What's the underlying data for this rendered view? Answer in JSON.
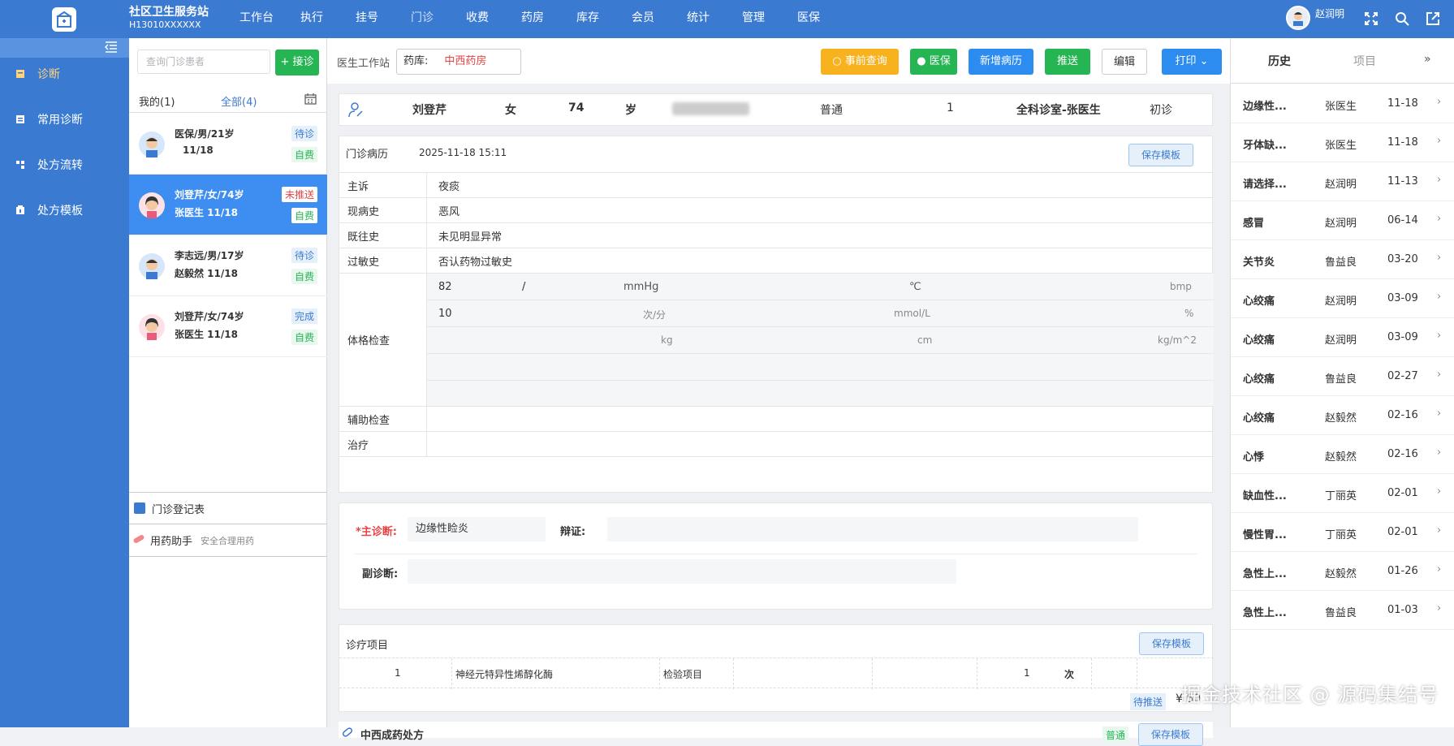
{
  "app": {
    "title": "社区卫生服务站",
    "subtitle": "H13010XXXXXX",
    "user": "赵润明"
  },
  "nav": [
    "工作台",
    "执行",
    "挂号",
    "门诊",
    "收费",
    "药房",
    "库存",
    "会员",
    "统计",
    "管理",
    "医保"
  ],
  "sidebar": [
    "诊断",
    "常用诊断",
    "处方流转",
    "处方模板"
  ],
  "patients": {
    "search_placeholder": "查询门诊患者",
    "receive_btn": "+ 接诊",
    "tab_mine": "我的(1)",
    "tab_all": "全部(4)",
    "list": [
      {
        "l1": "医保/男/21岁",
        "l2": "11/18",
        "status": "待诊",
        "pay": "自费"
      },
      {
        "l1": "刘登芹/女/74岁",
        "l2": "张医生   11/18",
        "status": "未推送",
        "pay": "自费"
      },
      {
        "l1": "李志远/男/17岁",
        "l2": "赵毅然   11/18",
        "status": "待诊",
        "pay": "自费"
      },
      {
        "l1": "刘登芹/女/74岁",
        "l2": "张医生   11/18",
        "status": "完成",
        "pay": "自费"
      }
    ],
    "foot1": "门诊登记表",
    "foot2": "用药助手",
    "foot2_sub": "安全合理用药"
  },
  "toolbar": {
    "workstation": "医生工作站",
    "pharmacy_label": "药库:",
    "pharmacy": "中西药房",
    "btn_pre": "事前查询",
    "btn_insure": "医保",
    "btn_new": "新增病历",
    "btn_push": "推送",
    "btn_edit": "编辑",
    "btn_print": "打印"
  },
  "patient": {
    "name": "刘登芹",
    "sex": "女",
    "age": "74",
    "age_unit": "岁",
    "type": "普通",
    "num": "1",
    "dept": "全科诊室-张医生",
    "visit": "初诊"
  },
  "record": {
    "title": "门诊病历",
    "date": "2025-11-18 15:11",
    "save_tpl": "保存模板",
    "chief": "主诉",
    "chief_v": "夜痰",
    "present": "现病史",
    "present_v": "恶风",
    "past": "既往史",
    "past_v": "未见明显异常",
    "allergy": "过敏史",
    "allergy_v": "否认药物过敏史",
    "exam": "体格检查",
    "v1": "82",
    "slash": "/",
    "mmhg": "mmHg",
    "c": "℃",
    "bmp": "bmp",
    "v2": "10",
    "cf": "次/分",
    "mmol": "mmol/L",
    "pct": "%",
    "kg": "kg",
    "cm": "cm",
    "bmi": "kg/m^2",
    "aux": "辅助检查",
    "treat": "治疗"
  },
  "diagnosis": {
    "main_label": "*主诊断:",
    "main_v": "边缘性睑炎",
    "syndrome_label": "辩证:",
    "sub_label": "副诊断:"
  },
  "treatment": {
    "title": "诊疗项目",
    "save_tpl": "保存模板",
    "row_idx": "1",
    "row_name": "神经元特异性烯醇化酶",
    "row_type": "检验项目",
    "row_qty": "1",
    "row_unit": "次",
    "status": "待推送",
    "price": "¥ 50"
  },
  "rx": {
    "title": "中西成药处方",
    "tag": "普通",
    "save_tpl": "保存模板"
  },
  "history": {
    "tab1": "历史",
    "tab2": "项目",
    "items": [
      {
        "n": "边缘性...",
        "d": "张医生",
        "t": "11-18"
      },
      {
        "n": "牙体缺...",
        "d": "张医生",
        "t": "11-18"
      },
      {
        "n": "请选择...",
        "d": "赵润明",
        "t": "11-13"
      },
      {
        "n": "感冒",
        "d": "赵润明",
        "t": "06-14"
      },
      {
        "n": "关节炎",
        "d": "鲁益良",
        "t": "03-20"
      },
      {
        "n": "心绞痛",
        "d": "赵润明",
        "t": "03-09"
      },
      {
        "n": "心绞痛",
        "d": "赵润明",
        "t": "03-09"
      },
      {
        "n": "心绞痛",
        "d": "鲁益良",
        "t": "02-27"
      },
      {
        "n": "心绞痛",
        "d": "赵毅然",
        "t": "02-16"
      },
      {
        "n": "心悸",
        "d": "赵毅然",
        "t": "02-16"
      },
      {
        "n": "缺血性...",
        "d": "丁丽英",
        "t": "02-01"
      },
      {
        "n": "慢性胃...",
        "d": "丁丽英",
        "t": "02-01"
      },
      {
        "n": "急性上...",
        "d": "赵毅然",
        "t": "01-26"
      },
      {
        "n": "急性上...",
        "d": "鲁益良",
        "t": "01-03"
      }
    ]
  },
  "watermark": "掘金技术社区 @ 源码集结号"
}
